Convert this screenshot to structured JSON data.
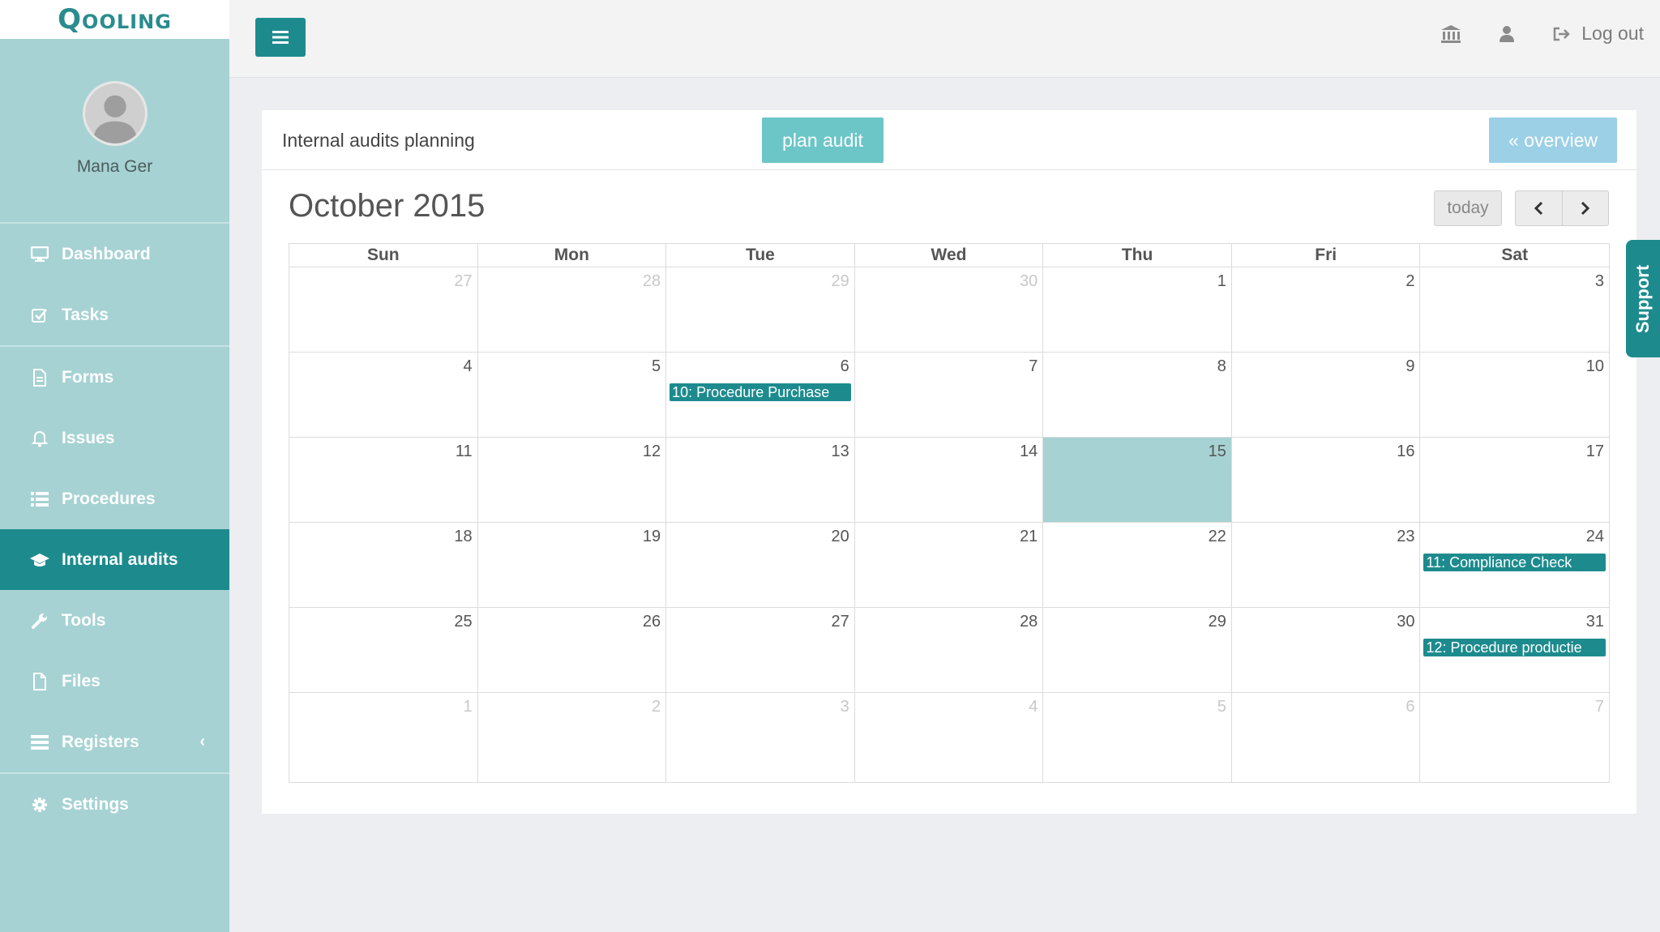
{
  "app": {
    "logo": "Qooling"
  },
  "user": {
    "name": "Mana Ger"
  },
  "sidebar": {
    "items": [
      {
        "label": "Dashboard",
        "icon": "monitor-icon"
      },
      {
        "label": "Tasks",
        "icon": "checkbox-icon"
      },
      {
        "label": "Forms",
        "icon": "document-icon"
      },
      {
        "label": "Issues",
        "icon": "bell-icon"
      },
      {
        "label": "Procedures",
        "icon": "list-icon"
      },
      {
        "label": "Internal audits",
        "icon": "graduation-cap-icon",
        "active": true
      },
      {
        "label": "Tools",
        "icon": "wrench-icon"
      },
      {
        "label": "Files",
        "icon": "file-icon"
      },
      {
        "label": "Registers",
        "icon": "table-icon",
        "chevron": "‹"
      },
      {
        "label": "Settings",
        "icon": "gear-icon"
      }
    ]
  },
  "topbar": {
    "menu_icon": "hamburger-icon",
    "logout_label": "Log out"
  },
  "panel": {
    "title": "Internal audits planning",
    "plan_audit_label": "plan audit",
    "overview_label": "« overview"
  },
  "calendar": {
    "title": "October 2015",
    "today_label": "today",
    "day_headers": [
      "Sun",
      "Mon",
      "Tue",
      "Wed",
      "Thu",
      "Fri",
      "Sat"
    ],
    "weeks": [
      [
        {
          "day": "27",
          "other": true
        },
        {
          "day": "28",
          "other": true
        },
        {
          "day": "29",
          "other": true
        },
        {
          "day": "30",
          "other": true
        },
        {
          "day": "1"
        },
        {
          "day": "2"
        },
        {
          "day": "3"
        }
      ],
      [
        {
          "day": "4"
        },
        {
          "day": "5"
        },
        {
          "day": "6",
          "event": "10: Procedure Purchase"
        },
        {
          "day": "7"
        },
        {
          "day": "8"
        },
        {
          "day": "9"
        },
        {
          "day": "10"
        }
      ],
      [
        {
          "day": "11"
        },
        {
          "day": "12"
        },
        {
          "day": "13"
        },
        {
          "day": "14"
        },
        {
          "day": "15",
          "today": true
        },
        {
          "day": "16"
        },
        {
          "day": "17"
        }
      ],
      [
        {
          "day": "18"
        },
        {
          "day": "19"
        },
        {
          "day": "20"
        },
        {
          "day": "21"
        },
        {
          "day": "22"
        },
        {
          "day": "23"
        },
        {
          "day": "24",
          "event": "11: Compliance Check"
        }
      ],
      [
        {
          "day": "25"
        },
        {
          "day": "26"
        },
        {
          "day": "27"
        },
        {
          "day": "28"
        },
        {
          "day": "29"
        },
        {
          "day": "30"
        },
        {
          "day": "31",
          "event": "12: Procedure productie"
        }
      ],
      [
        {
          "day": "1",
          "other": true
        },
        {
          "day": "2",
          "other": true
        },
        {
          "day": "3",
          "other": true
        },
        {
          "day": "4",
          "other": true
        },
        {
          "day": "5",
          "other": true
        },
        {
          "day": "6",
          "other": true
        },
        {
          "day": "7",
          "other": true
        }
      ]
    ]
  },
  "support": {
    "label": "Support"
  },
  "colors": {
    "brand": "#1d8b8e",
    "sidebar_bg": "#a6d2d3",
    "plan_button": "#6cc6c8",
    "overview_button": "#9bd0e6"
  }
}
